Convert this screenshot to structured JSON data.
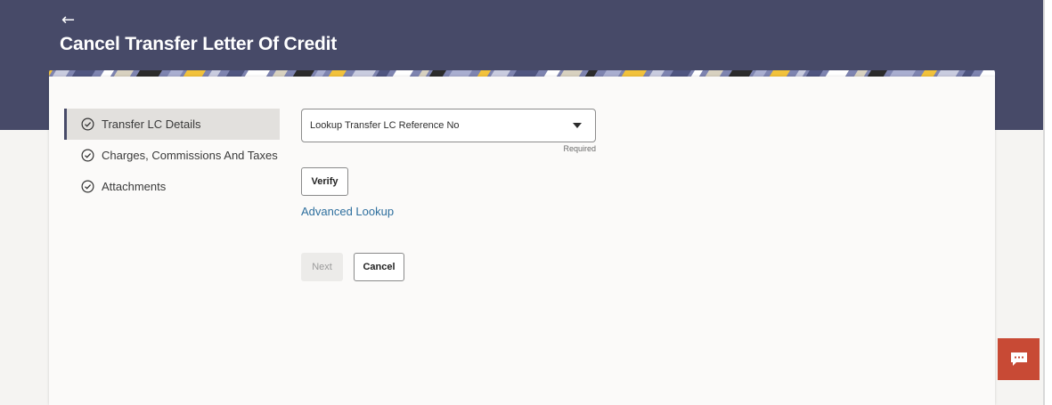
{
  "header": {
    "back_icon": "back-arrow-icon",
    "back_glyph": "←",
    "title": "Cancel Transfer Letter Of Credit"
  },
  "steps": [
    {
      "label": "Transfer LC Details",
      "icon": "check-circle-icon",
      "active": true
    },
    {
      "label": "Charges, Commissions And Taxes",
      "icon": "check-circle-icon",
      "active": false
    },
    {
      "label": "Attachments",
      "icon": "check-circle-icon",
      "active": false
    }
  ],
  "form": {
    "lookup_value": "Lookup Transfer LC Reference No",
    "required_label": "Required",
    "verify_label": "Verify",
    "advanced_lookup_label": "Advanced Lookup"
  },
  "actions": {
    "next_label": "Next",
    "cancel_label": "Cancel"
  },
  "chat": {
    "icon": "chat-icon"
  },
  "colors": {
    "header_bg": "#474a68",
    "link": "#2e6f9e",
    "chat_bg": "#c84a35",
    "active_step_bg": "#e2e0dd"
  }
}
